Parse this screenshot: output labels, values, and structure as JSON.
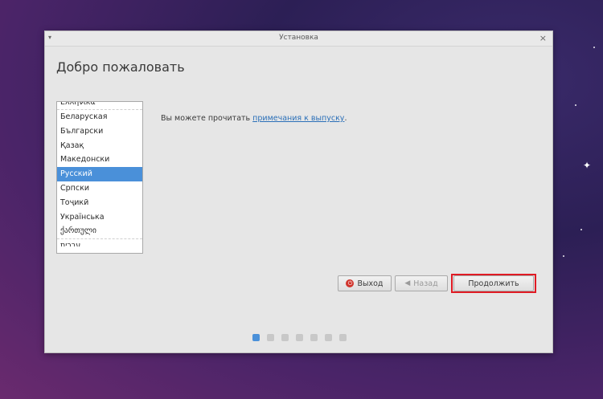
{
  "window": {
    "title": "Установка",
    "menu_icon": "chevron-down-icon",
    "close_icon": "close-icon"
  },
  "heading": "Добро пожаловать",
  "languages": {
    "partial_top": "Ελληνικά",
    "items": [
      "Беларуская",
      "Български",
      "Қазақ",
      "Македонски",
      "Русский",
      "Српски",
      "Тоҷикӣ",
      "Українська",
      "ქართული"
    ],
    "partial_bottom": "עברית",
    "selected": "Русский"
  },
  "release_notes": {
    "prefix": "Вы можете прочитать ",
    "link": "примечания к выпуску",
    "suffix": "."
  },
  "buttons": {
    "quit": "Выход",
    "back": "Назад",
    "continue": "Продолжить"
  },
  "progress": {
    "total_steps": 7,
    "current_step": 1
  },
  "colors": {
    "accent": "#4a90d9",
    "highlight": "#e01b24",
    "quit_icon": "#d0342c"
  }
}
